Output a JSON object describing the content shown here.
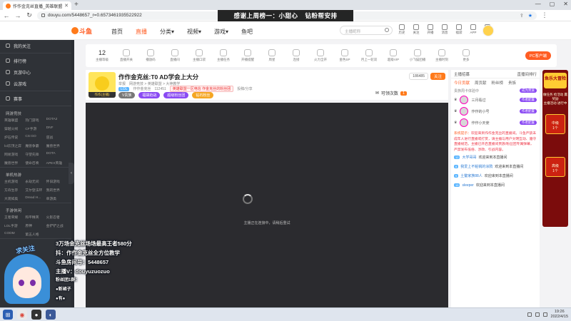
{
  "browser": {
    "tab_title": "作作金克丝直播_英雄联盟直播_",
    "url": "douyu.com/5448657_r=0.6573461935522922",
    "back_icon": "back-arrow-icon",
    "forward_icon": "forward-arrow-icon",
    "reload_icon": "reload-icon"
  },
  "site": {
    "logo_text": "斗鱼",
    "nav": [
      "首页",
      "直播",
      "分类▾",
      "视频▾",
      "游戏▾",
      "鱼吧"
    ],
    "active_nav": 1,
    "search_placeholder": "主播昵称",
    "header_icons": [
      {
        "label": "历史",
        "icon": "history-icon"
      },
      {
        "label": "关注",
        "icon": "follow-icon"
      },
      {
        "label": "开播",
        "icon": "broadcast-icon"
      },
      {
        "label": "消息",
        "icon": "message-icon"
      },
      {
        "label": "福袋",
        "icon": "gift-icon"
      },
      {
        "label": "APP",
        "icon": "app-icon"
      },
      {
        "label": "客户端",
        "icon": "client-icon"
      }
    ],
    "accent": "#ff5d23"
  },
  "sidebar": {
    "items": [
      {
        "label": "我的关注",
        "icon": "heart-icon"
      },
      {
        "label": "排行榜",
        "icon": "ranking-icon"
      },
      {
        "label": "页游中心",
        "icon": "game-center-icon"
      },
      {
        "label": "云游戏",
        "icon": "cloud-game-icon"
      },
      {
        "label": "赛事",
        "icon": "trophy-icon"
      }
    ],
    "sections": [
      {
        "title": "网游竞技",
        "items": [
          "英雄联盟",
          "热门游戏",
          "DOTA2",
          "穿越火线",
          "CF手游",
          "DNF",
          "炉石传说",
          "CS:GO",
          "逆战",
          "lol云顶之弈",
          "魔兽争霸",
          "魔兽世界",
          "网易游戏",
          "守望先锋",
          "DOTA",
          "魔兽世界",
          "使命召唤",
          "APEX英雄"
        ]
      },
      {
        "title": "单机热游",
        "items": [
          "主机游戏",
          "永劫无间",
          "怀旧游戏",
          "方舟生存",
          "艾尔登法环",
          "我的世界",
          "大观如奥",
          "Dread H...",
          "单游类"
        ]
      },
      {
        "title": "手游休闲",
        "items": [
          "王者荣耀",
          "和平精英",
          "火影忍者",
          "LOL手游",
          "原神",
          "金铲铲之战",
          "CODM",
          "第五人格"
        ]
      }
    ],
    "collapse_icon": "chevron-left-icon"
  },
  "room": {
    "gift_bar": [
      {
        "label": "主播等级",
        "num": "12"
      },
      {
        "label": "直播开关",
        "icon": "live-icon"
      },
      {
        "label": "播放码",
        "icon": "wave-icon"
      },
      {
        "label": "直播间",
        "icon": "room-icon"
      },
      {
        "label": "主播口袋",
        "icon": "pocket-icon"
      },
      {
        "label": "主播任务",
        "icon": "task-icon"
      },
      {
        "label": "开播提醒",
        "icon": "bell-icon"
      },
      {
        "label": "周星",
        "icon": "star-icon"
      },
      {
        "label": "连接",
        "icon": "link-icon"
      },
      {
        "label": "火力全开",
        "icon": "fire-icon"
      },
      {
        "label": "金色SP",
        "icon": "sp-icon"
      },
      {
        "label": "月上一轮双",
        "icon": "car-icon"
      },
      {
        "label": "超级VIP",
        "icon": "diamond-icon"
      },
      {
        "label": "小飞猫团播",
        "icon": "cat-icon"
      },
      {
        "label": "主播时刻",
        "icon": "clock-icon"
      },
      {
        "label": "更多",
        "icon": "more-icon"
      }
    ],
    "pc_download": "PC客户端",
    "title": "作作金克丝:T0 AD学会上大分",
    "report": "举报",
    "category_link": "网游竞技 > 英雄联盟 > 大神教学",
    "tag_blue": "LOL",
    "anchor_name": "作作金克丝",
    "hot_count": "112451",
    "tag_red": "英雄联盟一区电信 作金克丝的粉丝团",
    "share": "投稿/分享",
    "anchor_level": "作作(主播)",
    "badges": [
      "V贵族",
      "福袋抢战",
      "超级粉丝团",
      "钻石粉丝"
    ],
    "follow_count": "186485",
    "follow_label": "关注",
    "claim_label": "可领次数",
    "claim_num": "1",
    "player_message": "主播正在连接中，请稍后重试"
  },
  "chat": {
    "top_left": "主播招募",
    "top_right": "直播间排行",
    "tabs": [
      "今日贡献",
      "周贡献",
      "粉丝榜",
      "贵族"
    ],
    "active_tab": 0,
    "notice": "贵族周卡体验中",
    "notice_btn": "成为贵族",
    "ranks": [
      {
        "name": "三月看过",
        "btn": "作者配置"
      },
      {
        "name": "作作的小号",
        "btn": "作者配置"
      },
      {
        "name": "作作小天使",
        "btn": "作者配置"
      }
    ],
    "system_label": "系统提示：",
    "system_text": "欢迎来到作作金克丝的直播间。斗鱼严禁未成年人进行直播或打赏，请主播与用户文明互动、遵守直播规范。主播已开启直播间贵族/粉丝团专属弹幕，严禁发布低俗、涉政、引战内容。",
    "messages": [
      {
        "level": "12",
        "user": "大学哥哥",
        "text": "欢迎来到本直播间"
      },
      {
        "level": "8",
        "user": "我爱上不粘锅的涂鸦",
        "text": "欢迎来到本直播间"
      },
      {
        "level": "9",
        "user": "土鳖家族88人",
        "text": "欢迎来到本直播间"
      },
      {
        "level": "15",
        "user": "sleeper",
        "text": "欢迎来到本直播间"
      }
    ]
  },
  "promo": {
    "title": "鱼乐大冒险",
    "line1": "做任务 抢活动 赢奖励",
    "line2": "主播活动 进行中",
    "box1": "中级",
    "box2": "高级",
    "count": "1个"
  },
  "overlay": {
    "banner_left": "感谢上周榜一：小甜心",
    "banner_right": "钻粉帮安排",
    "follow": "求关注",
    "lines": [
      "3万场金克丝场场最高王者580分",
      "抖：作作金克丝全方位教学",
      "斗鱼房间号：5448657",
      "主播V：douyuzuozuo",
      "粉丝团1群：",
      "●新裙子",
      "●有●"
    ]
  },
  "taskbar": {
    "apps": [
      "windows-start-icon",
      "chrome-icon",
      "obs-icon",
      "app-icon"
    ],
    "time": "19:26",
    "date": "2022/4/15"
  }
}
